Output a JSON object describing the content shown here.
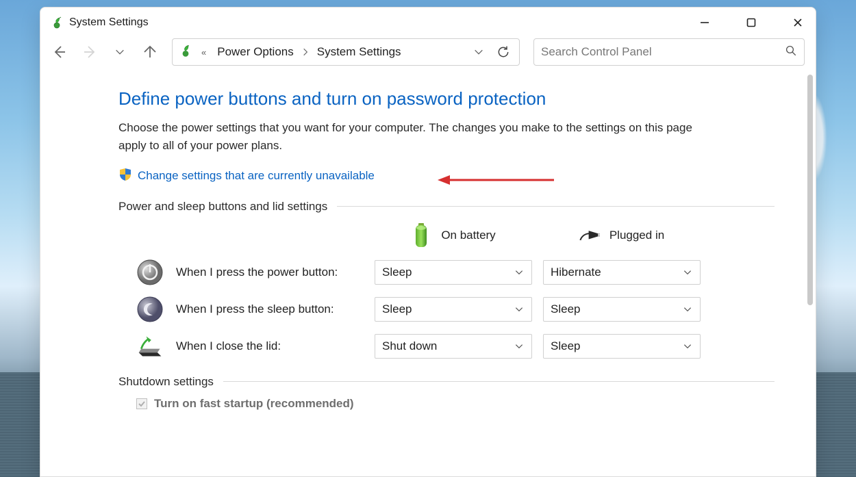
{
  "titlebar": {
    "title": "System Settings"
  },
  "breadcrumb": {
    "overflow": "«",
    "crumb1": "Power Options",
    "crumb2": "System Settings"
  },
  "search": {
    "placeholder": "Search Control Panel"
  },
  "page": {
    "heading": "Define power buttons and turn on password protection",
    "description": "Choose the power settings that you want for your computer. The changes you make to the settings on this page apply to all of your power plans.",
    "admin_link": "Change settings that are currently unavailable"
  },
  "sections": {
    "power_sleep_lid": {
      "legend": "Power and sleep buttons and lid settings"
    },
    "shutdown": {
      "legend": "Shutdown settings"
    }
  },
  "headers": {
    "on_battery": "On battery",
    "plugged_in": "Plugged in"
  },
  "rows": {
    "power_button": {
      "label": "When I press the power button:",
      "battery": "Sleep",
      "plugged": "Hibernate"
    },
    "sleep_button": {
      "label": "When I press the sleep button:",
      "battery": "Sleep",
      "plugged": "Sleep"
    },
    "close_lid": {
      "label": "When I close the lid:",
      "battery": "Shut down",
      "plugged": "Sleep"
    }
  },
  "fast_startup": {
    "label": "Turn on fast startup (recommended)",
    "checked": true
  }
}
